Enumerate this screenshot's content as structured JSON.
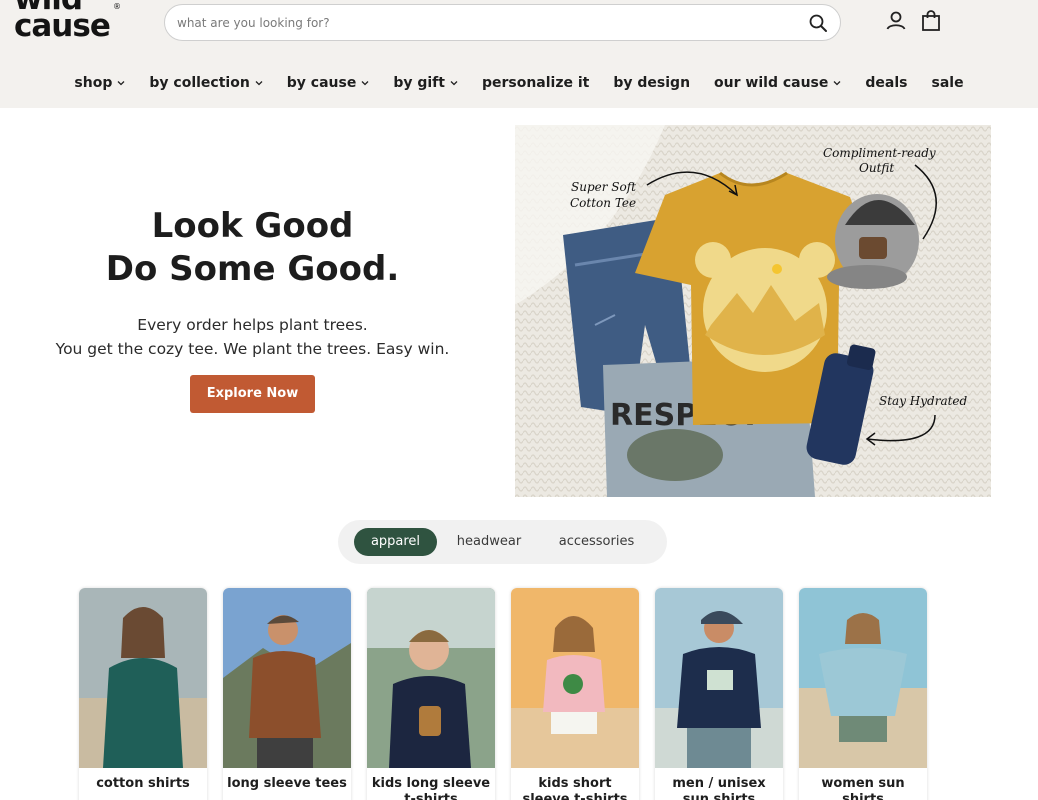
{
  "brand": {
    "logo_line1": "wild",
    "logo_line2": "cause",
    "logo_mark": "®"
  },
  "search": {
    "placeholder": "what are you looking for?",
    "icon": "search-icon"
  },
  "header_icons": {
    "account": "account-icon",
    "cart": "cart-icon"
  },
  "nav": [
    {
      "label": "shop",
      "dropdown": true
    },
    {
      "label": "by collection",
      "dropdown": true
    },
    {
      "label": "by cause",
      "dropdown": true
    },
    {
      "label": "by gift",
      "dropdown": true
    },
    {
      "label": "personalize it",
      "dropdown": false
    },
    {
      "label": "by design",
      "dropdown": false
    },
    {
      "label": "our wild cause",
      "dropdown": true
    },
    {
      "label": "deals",
      "dropdown": false
    },
    {
      "label": "sale",
      "dropdown": false
    }
  ],
  "hero": {
    "title_line1": "Look Good",
    "title_line2": "Do Some Good.",
    "subtitle_line1": "Every order helps plant trees.",
    "subtitle_line2": "You get the cozy tee. We plant the trees. Easy win.",
    "cta": "Explore Now",
    "captions": {
      "tee": [
        "Super Soft",
        "Cotton Tee"
      ],
      "outfit": [
        "Compliment-ready",
        "Outfit"
      ],
      "hydrated": "Stay Hydrated"
    },
    "shirt_print": "RESPECT"
  },
  "category_tabs": [
    {
      "label": "apparel",
      "active": true
    },
    {
      "label": "headwear",
      "active": false
    },
    {
      "label": "accessories",
      "active": false
    }
  ],
  "categories": [
    {
      "label": "cotton shirts"
    },
    {
      "label": "long sleeve tees"
    },
    {
      "label": "kids long sleeve t-shirts"
    },
    {
      "label": "kids short sleeve t-shirts"
    },
    {
      "label": "men / unisex sun shirts"
    },
    {
      "label": "women sun shirts"
    }
  ],
  "colors": {
    "accent": "#c15a33",
    "tab_active": "#2f5340",
    "header_bg": "#f3f1ee"
  }
}
